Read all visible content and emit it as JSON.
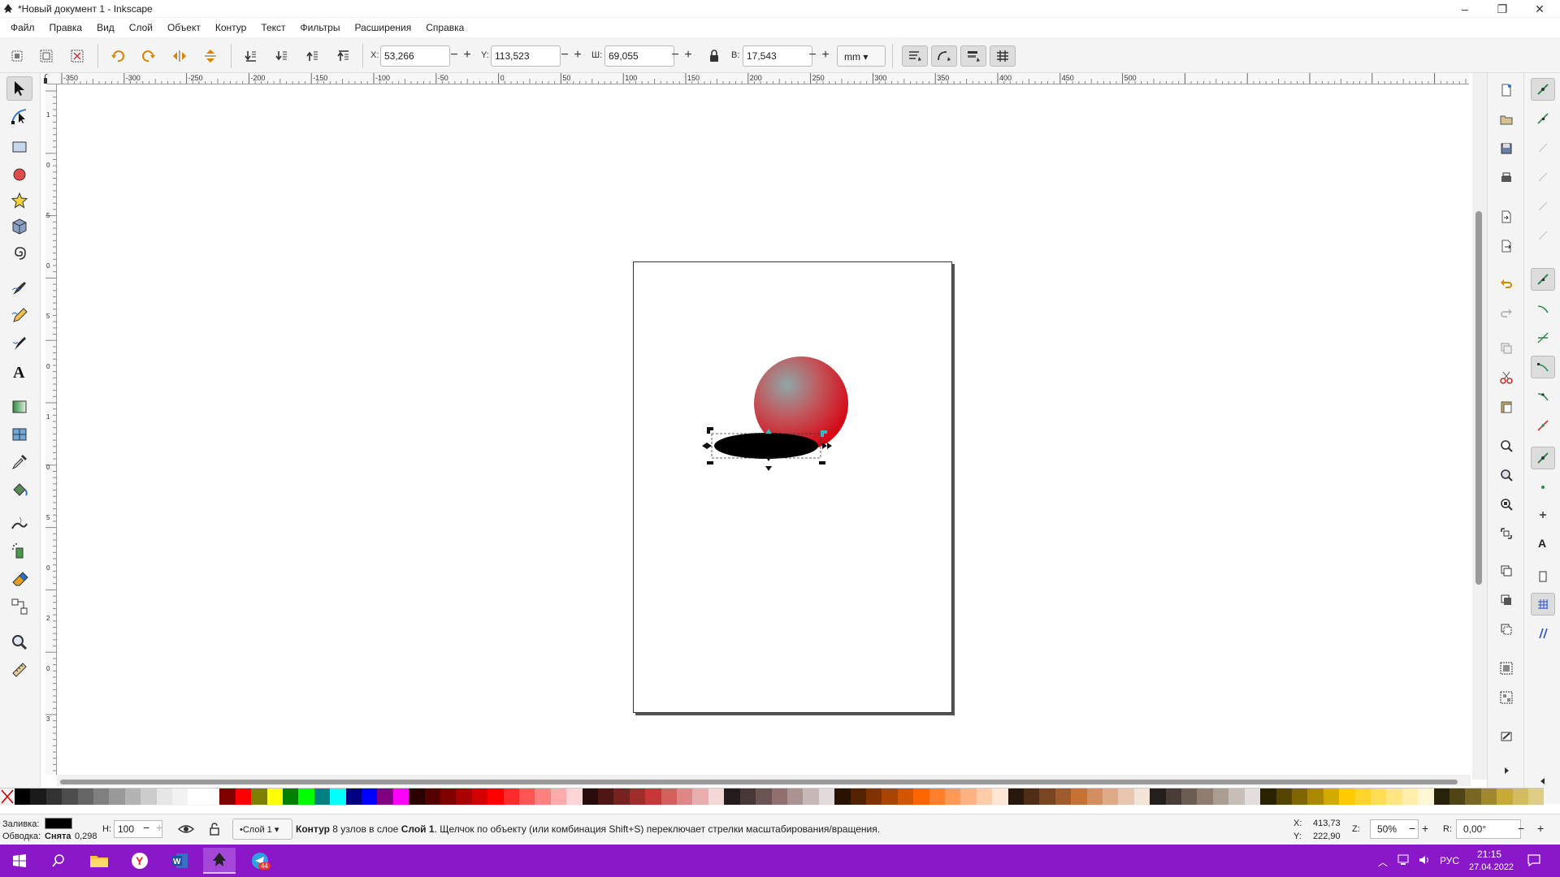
{
  "window": {
    "title": "*Новый документ 1 - Inkscape",
    "controls": [
      "–",
      "❐",
      "✕"
    ]
  },
  "menu": [
    "Файл",
    "Правка",
    "Вид",
    "Слой",
    "Объект",
    "Контур",
    "Текст",
    "Фильтры",
    "Расширения",
    "Справка"
  ],
  "toolbar": {
    "x_label": "X:",
    "x_value": "53,266",
    "y_label": "Y:",
    "y_value": "113,523",
    "w_label": "Ш:",
    "w_value": "69,055",
    "h_label": "В:",
    "h_value": "17,543",
    "unit": "mm"
  },
  "ruler_h_labels": [
    "-350",
    "-300",
    "-250",
    "-200",
    "-150",
    "-100",
    "-50",
    "0",
    "50",
    "100",
    "150",
    "200",
    "250",
    "300",
    "350",
    "400",
    "450",
    "500"
  ],
  "ruler_v_labels": [
    "1",
    "0",
    "5",
    "0",
    "5",
    "0",
    "1",
    "0",
    "5",
    "0",
    "2",
    "0",
    "3"
  ],
  "left_tools": [
    "selector-tool",
    "node-tool",
    "rect-tool",
    "ellipse-tool",
    "star-tool",
    "3dbox-tool",
    "spiral-tool",
    "pen-tool",
    "pencil-tool",
    "calligraphy-tool",
    "text-tool",
    "gradient-tool",
    "mesh-tool",
    "dropper-tool",
    "paint-bucket-tool",
    "tweak-tool",
    "spray-tool",
    "eraser-tool",
    "connector-tool",
    "zoom-tool",
    "measure-tool"
  ],
  "palette": [
    "#000000",
    "#1a1a1a",
    "#333333",
    "#4d4d4d",
    "#666666",
    "#808080",
    "#999999",
    "#b3b3b3",
    "#cccccc",
    "#e6e6e6",
    "#f2f2f2",
    "#ffffff",
    "#ffffff",
    "#800000",
    "#ff0000",
    "#808000",
    "#ffff00",
    "#008000",
    "#00ff00",
    "#008080",
    "#00ffff",
    "#000080",
    "#0000ff",
    "#800080",
    "#ff00ff",
    "#2b0000",
    "#550000",
    "#800000",
    "#aa0000",
    "#d40000",
    "#ff0000",
    "#ff2a2a",
    "#ff5555",
    "#ff8080",
    "#ffaaaa",
    "#ffd5d5",
    "#280b0b",
    "#501616",
    "#782121",
    "#a02c2c",
    "#c83737",
    "#d35f5f",
    "#de8787",
    "#e9afaf",
    "#f4d7d7",
    "#241c1c",
    "#483737",
    "#6c5353",
    "#916f6f",
    "#ac9393",
    "#c8b7b7",
    "#e3dbdb",
    "#2b1100",
    "#552200",
    "#803300",
    "#aa4400",
    "#d45500",
    "#ff6600",
    "#ff7f2a",
    "#ff9955",
    "#ffb380",
    "#ffccaa",
    "#ffe6d5",
    "#28170b",
    "#502d16",
    "#784421",
    "#a05a2c",
    "#c87137",
    "#d38d5f",
    "#deaa87",
    "#e9c6af",
    "#f4e3d7",
    "#241f1c",
    "#483e37",
    "#6c5d53",
    "#917c6f",
    "#ac9d93",
    "#c8beb7",
    "#e3dedb",
    "#2b2200",
    "#554400",
    "#806600",
    "#aa8800",
    "#d4aa00",
    "#ffcc00",
    "#ffd42a",
    "#ffdd55",
    "#ffe680",
    "#ffeeaa",
    "#fff6d5",
    "#28220b",
    "#504416",
    "#786721",
    "#a0892c",
    "#c8ab37",
    "#d3bc5f",
    "#decd87"
  ],
  "status": {
    "fill_label": "Заливка:",
    "fill_color": "#000000",
    "stroke_label": "Обводка:",
    "stroke_value": "Снята",
    "stroke_width": "0,298",
    "opacity_label": "Н:",
    "opacity_value": "100",
    "layer": "•Слой 1",
    "msg_bold1": "Контур",
    "msg_mid": " 8 узлов в слое ",
    "msg_bold2": "Слой 1",
    "msg_tail": ". Щелчок по объекту (или комбинация Shift+S) переключает стрелки масштабирования/вращения.",
    "cursor_x_label": "X:",
    "cursor_x": "413,73",
    "cursor_y_label": "Y:",
    "cursor_y": "222,90",
    "zoom_label": "Z:",
    "zoom_value": "50%",
    "rotate_label": "R:",
    "rotate_value": "0,00°"
  },
  "taskbar": {
    "lang": "РУС",
    "time": "21:15",
    "date": "27.04.2022",
    "telegram_badge": "44"
  }
}
